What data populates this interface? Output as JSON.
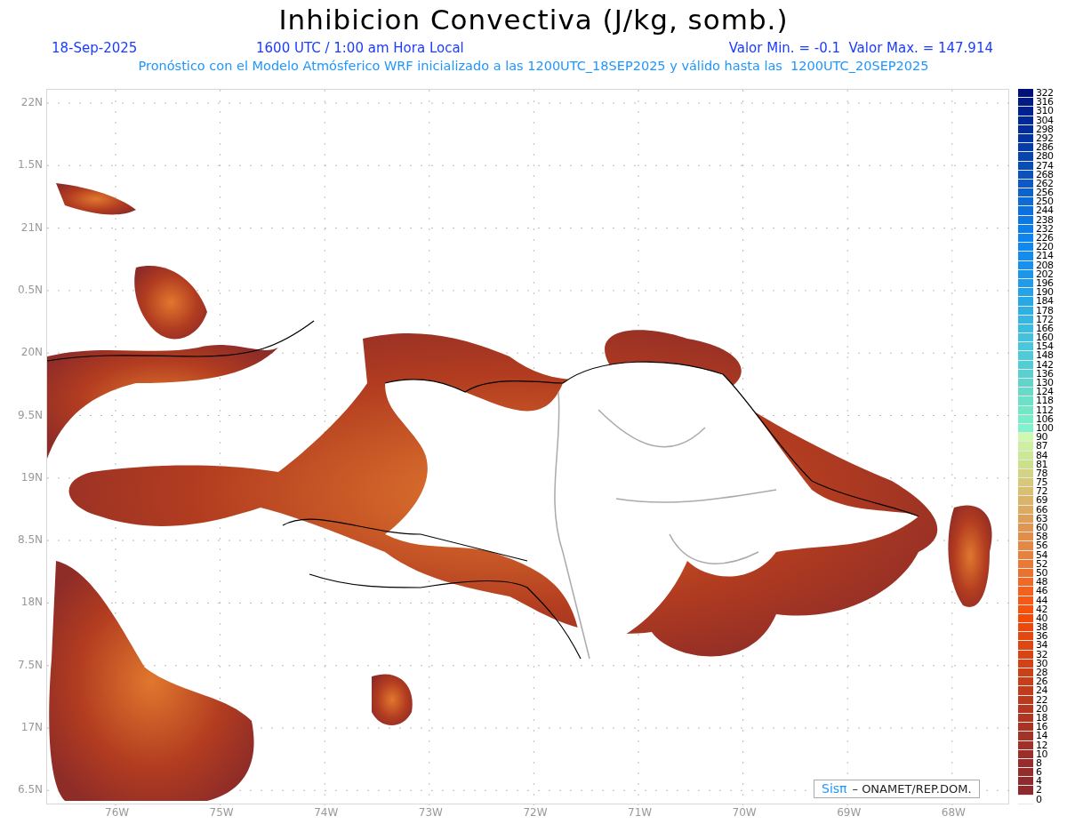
{
  "title": "Inhibicion Convectiva (J/kg, somb.)",
  "info": {
    "date": "18-Sep-2025",
    "time": "1600 UTC / 1:00 am Hora Local",
    "range": "Valor Min. = -0.1  Valor Max. = 147.914",
    "forecast": "Pronóstico con el Modelo Atmósferico WRF inicializado a las 1200UTC_18SEP2025 y válido hasta las  1200UTC_20SEP2025"
  },
  "lat_labels": [
    "22N",
    "1.5N",
    "21N",
    "0.5N",
    "20N",
    "9.5N",
    "19N",
    "8.5N",
    "18N",
    "7.5N",
    "17N",
    "6.5N"
  ],
  "lon_labels": [
    "76W",
    "75W",
    "74W",
    "73W",
    "72W",
    "71W",
    "70W",
    "69W",
    "68W"
  ],
  "credit": {
    "brand": "Sisπ",
    "text": "– ONAMET/REP.DOM."
  },
  "legend": [
    {
      "label": "322",
      "color": "#00107a"
    },
    {
      "label": "316",
      "color": "#001a88"
    },
    {
      "label": "310",
      "color": "#00228f"
    },
    {
      "label": "304",
      "color": "#002896"
    },
    {
      "label": "298",
      "color": "#022e9c"
    },
    {
      "label": "292",
      "color": "#0434a2"
    },
    {
      "label": "286",
      "color": "#063ca8"
    },
    {
      "label": "280",
      "color": "#0844ae"
    },
    {
      "label": "274",
      "color": "#0a4cb6"
    },
    {
      "label": "268",
      "color": "#0c52bc"
    },
    {
      "label": "262",
      "color": "#0e5ac4"
    },
    {
      "label": "256",
      "color": "#0e62cc"
    },
    {
      "label": "250",
      "color": "#0e6ad4"
    },
    {
      "label": "244",
      "color": "#0e70dc"
    },
    {
      "label": "238",
      "color": "#0e78e2"
    },
    {
      "label": "232",
      "color": "#0e7ee8"
    },
    {
      "label": "226",
      "color": "#0e84ee"
    },
    {
      "label": "220",
      "color": "#1088f0"
    },
    {
      "label": "214",
      "color": "#148cee"
    },
    {
      "label": "208",
      "color": "#1890ec"
    },
    {
      "label": "202",
      "color": "#1c96ea"
    },
    {
      "label": "196",
      "color": "#229ce8"
    },
    {
      "label": "190",
      "color": "#26a2e6"
    },
    {
      "label": "184",
      "color": "#2aa8e4"
    },
    {
      "label": "178",
      "color": "#30b0e2"
    },
    {
      "label": "172",
      "color": "#36b6e0"
    },
    {
      "label": "166",
      "color": "#3cbcde"
    },
    {
      "label": "160",
      "color": "#42c2dc"
    },
    {
      "label": "154",
      "color": "#48c8da"
    },
    {
      "label": "148",
      "color": "#4ecad8"
    },
    {
      "label": "142",
      "color": "#54ccd4"
    },
    {
      "label": "136",
      "color": "#5ad0d0"
    },
    {
      "label": "130",
      "color": "#62d4cc"
    },
    {
      "label": "124",
      "color": "#68dac8"
    },
    {
      "label": "118",
      "color": "#6ee0c8"
    },
    {
      "label": "112",
      "color": "#74e6c8"
    },
    {
      "label": "106",
      "color": "#7aecca"
    },
    {
      "label": "100",
      "color": "#80f2cc"
    },
    {
      "label": "90",
      "color": "#d0f8b0"
    },
    {
      "label": "87",
      "color": "#ccf0a0"
    },
    {
      "label": "84",
      "color": "#cce894"
    },
    {
      "label": "81",
      "color": "#cce08c"
    },
    {
      "label": "78",
      "color": "#d2d484"
    },
    {
      "label": "75",
      "color": "#d8c87c"
    },
    {
      "label": "72",
      "color": "#d8c070"
    },
    {
      "label": "69",
      "color": "#dab468"
    },
    {
      "label": "66",
      "color": "#dcaa60"
    },
    {
      "label": "63",
      "color": "#dea058"
    },
    {
      "label": "60",
      "color": "#e09650"
    },
    {
      "label": "58",
      "color": "#e28e48"
    },
    {
      "label": "56",
      "color": "#e48844"
    },
    {
      "label": "54",
      "color": "#e6823e"
    },
    {
      "label": "52",
      "color": "#e87a36"
    },
    {
      "label": "50",
      "color": "#ea722e"
    },
    {
      "label": "48",
      "color": "#ee6a26"
    },
    {
      "label": "46",
      "color": "#f2621e"
    },
    {
      "label": "44",
      "color": "#f45a14"
    },
    {
      "label": "42",
      "color": "#f6520c"
    },
    {
      "label": "40",
      "color": "#f44c08"
    },
    {
      "label": "38",
      "color": "#ea4a0c"
    },
    {
      "label": "36",
      "color": "#e44810"
    },
    {
      "label": "34",
      "color": "#de4612"
    },
    {
      "label": "32",
      "color": "#d84414"
    },
    {
      "label": "30",
      "color": "#d24216"
    },
    {
      "label": "28",
      "color": "#cc4018"
    },
    {
      "label": "26",
      "color": "#c63e1a"
    },
    {
      "label": "24",
      "color": "#c03c1c"
    },
    {
      "label": "22",
      "color": "#ba3a1e"
    },
    {
      "label": "20",
      "color": "#b43820"
    },
    {
      "label": "18",
      "color": "#ae3622"
    },
    {
      "label": "16",
      "color": "#a83424"
    },
    {
      "label": "14",
      "color": "#a43226"
    },
    {
      "label": "12",
      "color": "#a03028"
    },
    {
      "label": "10",
      "color": "#9c2e2a"
    },
    {
      "label": "8",
      "color": "#982c2c"
    },
    {
      "label": "6",
      "color": "#942c2c"
    },
    {
      "label": "4",
      "color": "#902a2e"
    },
    {
      "label": "2",
      "color": "#8c2a2e"
    },
    {
      "label": "0",
      "color": "#ffffff"
    }
  ]
}
